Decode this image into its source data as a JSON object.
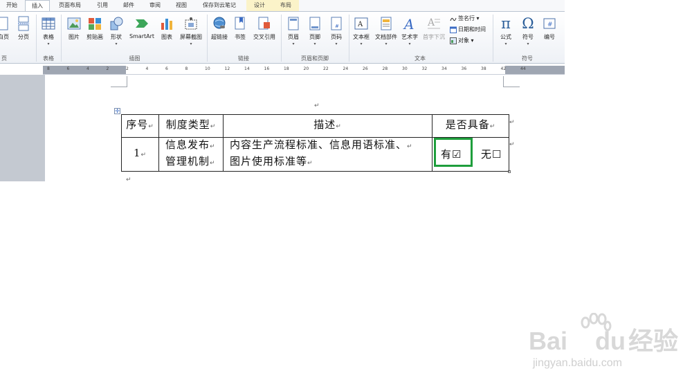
{
  "ribbon": {
    "tabs": [
      {
        "label": "开始"
      },
      {
        "label": "插入"
      },
      {
        "label": "页面布局"
      },
      {
        "label": "引用"
      },
      {
        "label": "邮件"
      },
      {
        "label": "审阅"
      },
      {
        "label": "视图"
      },
      {
        "label": "保存到云笔记"
      },
      {
        "label": "设计"
      },
      {
        "label": "布局"
      }
    ],
    "buttons": {
      "blank_page": "白页",
      "page_break": "分页",
      "table": "表格",
      "picture": "图片",
      "clipart": "剪贴画",
      "shapes": "形状",
      "smartart": "SmartArt",
      "chart": "图表",
      "screenshot": "屏幕截图",
      "hyperlink": "超链接",
      "bookmark": "书签",
      "cross_ref": "交叉引用",
      "header": "页眉",
      "footer": "页脚",
      "page_number": "页码",
      "textbox": "文本框",
      "quick_parts": "文档部件",
      "wordart": "艺术字",
      "dropcap": "首字下沉",
      "signature": "签名行",
      "datetime": "日期和时间",
      "object": "对象",
      "equation": "公式",
      "symbol": "符号",
      "numbering": "编号"
    },
    "groups": {
      "pages": "页",
      "tables": "表格",
      "illustrations": "插图",
      "links": "链接",
      "header_footer": "页眉和页脚",
      "text": "文本",
      "symbols": "符号"
    }
  },
  "ruler": {
    "ticks": [
      "8",
      "6",
      "4",
      "2",
      "2",
      "4",
      "6",
      "8",
      "10",
      "12",
      "14",
      "16",
      "18",
      "20",
      "22",
      "24",
      "26",
      "28",
      "30",
      "32",
      "34",
      "36",
      "38",
      "42",
      "44"
    ]
  },
  "document": {
    "table": {
      "headers": [
        "序号",
        "制度类型",
        "描述",
        "是否具备"
      ],
      "row": {
        "no": "1",
        "type_line1": "信息发布",
        "type_line2": "管理机制",
        "desc_line1": "内容生产流程标准、信息用语标准、",
        "desc_line2": "图片使用标准等",
        "yes": "有☑",
        "no_option": "无☐"
      }
    },
    "marks": {
      "para": "↵",
      "move": "✛"
    }
  },
  "watermark": {
    "brand": "Bai",
    "brand2": "du",
    "cn": "经验",
    "url": "jingyan.baidu.com"
  }
}
